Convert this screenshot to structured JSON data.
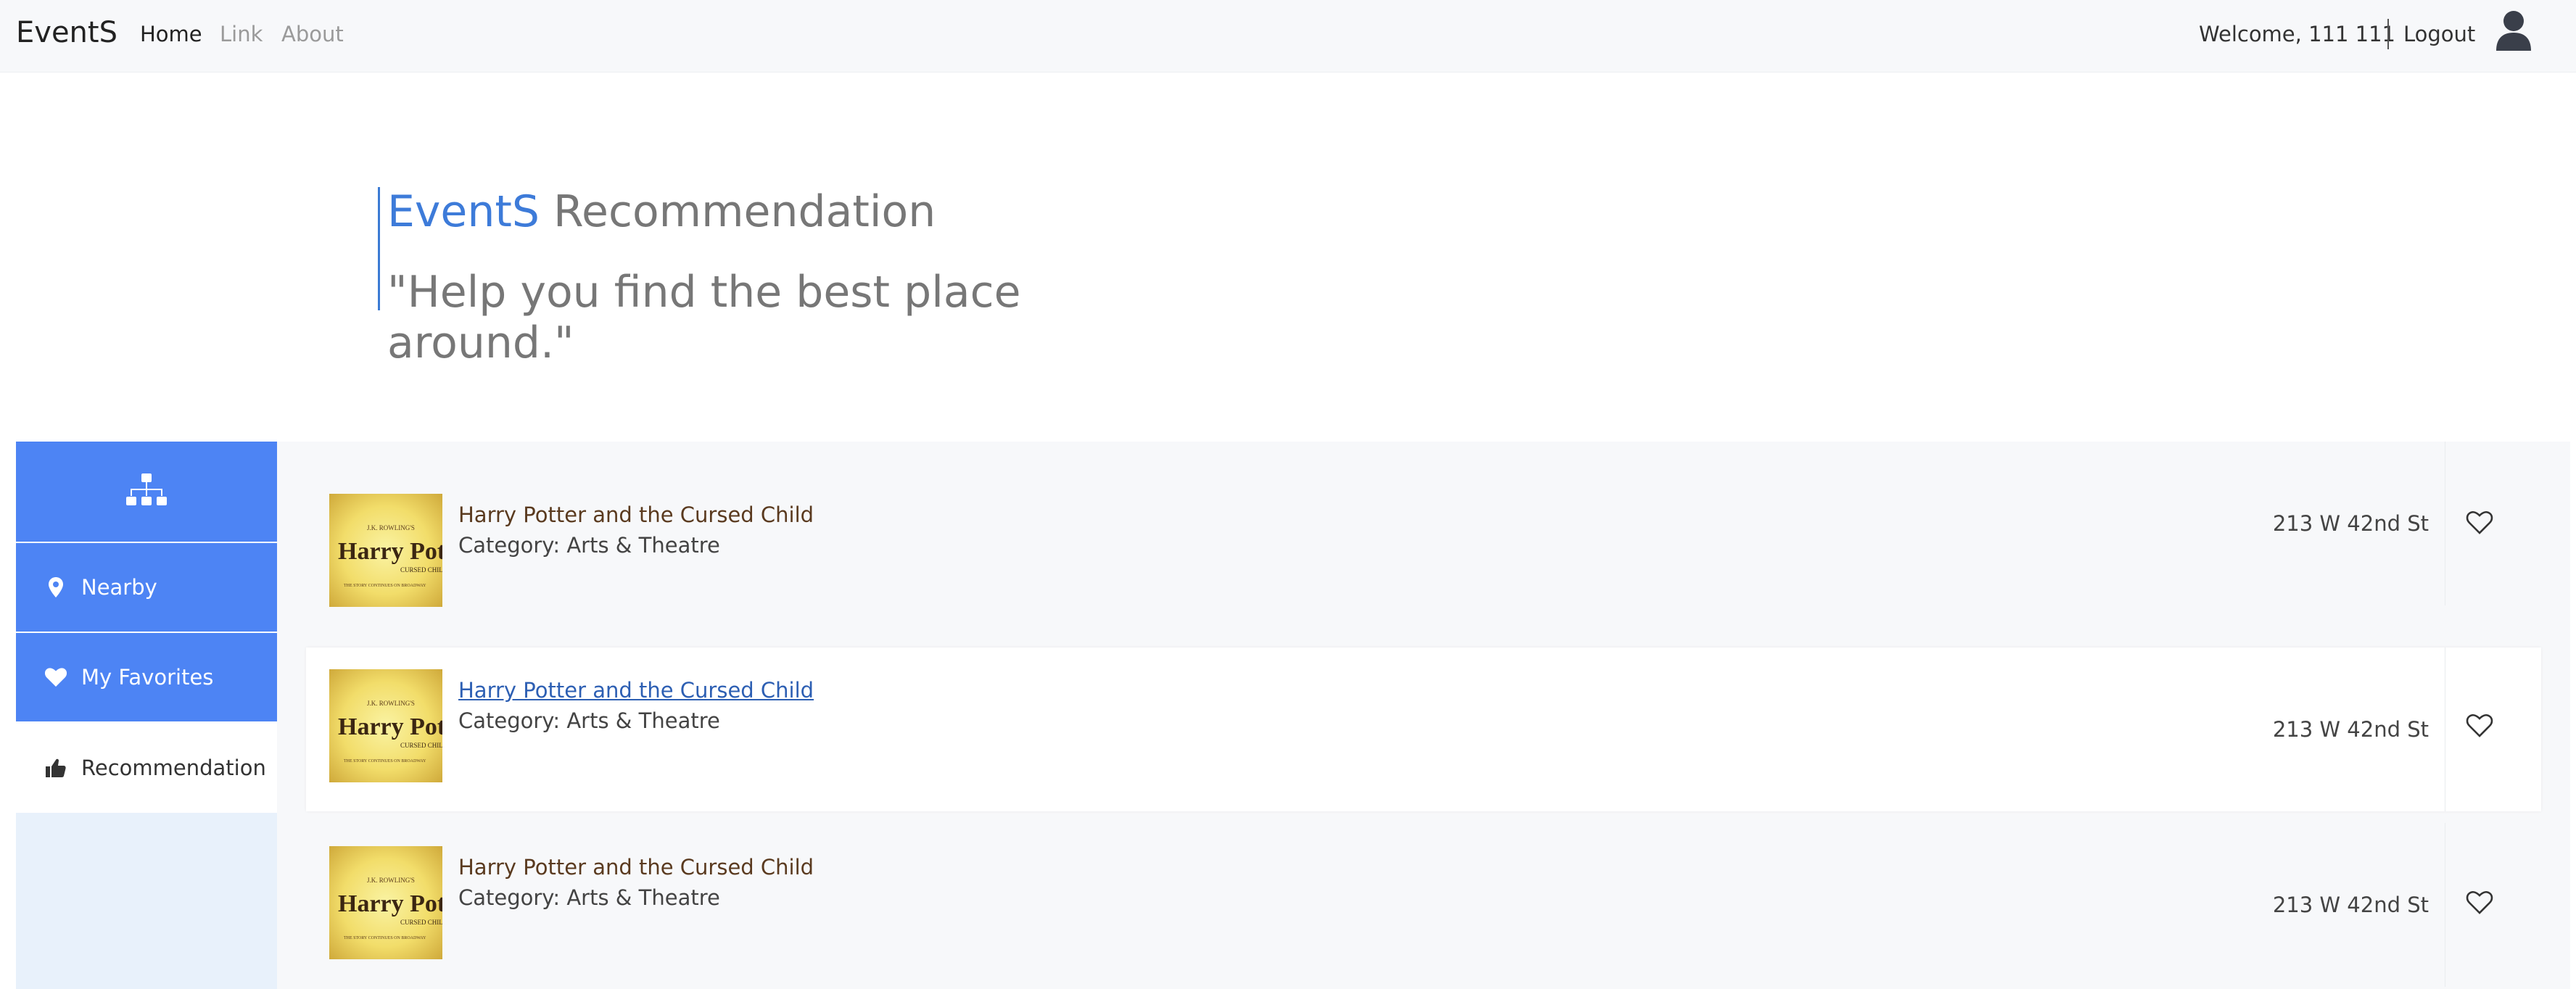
{
  "nav": {
    "brand": "EventS",
    "links": [
      "Home",
      "Link",
      "About"
    ],
    "welcome": "Welcome, 111 111",
    "logout": "Logout"
  },
  "header": {
    "brand_word": "EventS",
    "title_rest": " Recommendation",
    "slogan": "\"Help you find the best place around.\""
  },
  "sidebar": {
    "items": [
      {
        "label": "Nearby",
        "icon": "map-pin-icon"
      },
      {
        "label": "My Favorites",
        "icon": "heart-icon"
      },
      {
        "label": "Recommendation",
        "icon": "thumbs-up-icon"
      }
    ]
  },
  "items": [
    {
      "title": "Harry Potter and the Cursed Child",
      "category": "Category: Arts & Theatre",
      "address": "213 W 42nd St"
    },
    {
      "title": "Harry Potter and the Cursed Child",
      "category": "Category: Arts & Theatre",
      "address": "213 W 42nd St"
    },
    {
      "title": "Harry Potter and the Cursed Child",
      "category": "Category: Arts & Theatre",
      "address": "213 W 42nd St"
    }
  ],
  "thumb_text": {
    "author": "J.K. ROWLING'S",
    "title": "Harry Potter",
    "subtitle": "CURSED CHILD",
    "tagline": "THE STORY CONTINUES ON BROADWAY"
  },
  "colors": {
    "accent": "#4d84f4",
    "brand_blue": "#3d7bd9",
    "sidebar_bg": "#e8f1fb"
  }
}
